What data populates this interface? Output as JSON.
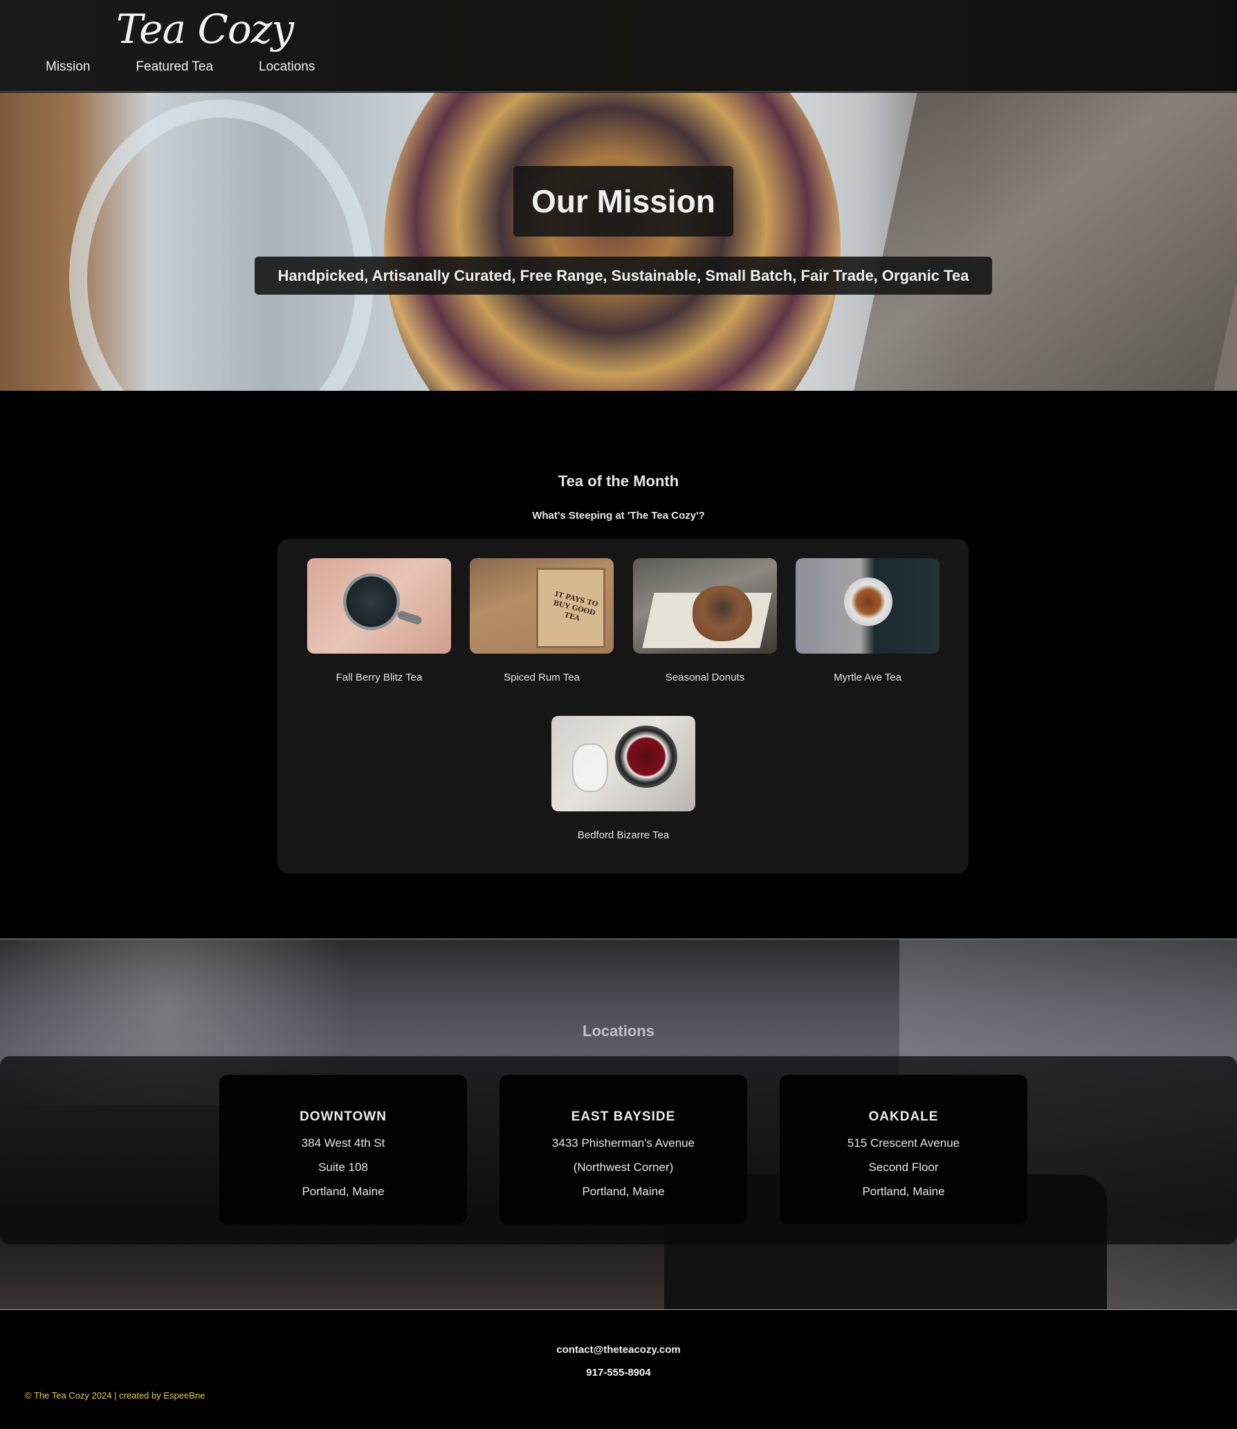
{
  "header": {
    "logo": "Tea Cozy",
    "nav": [
      {
        "label": "Mission"
      },
      {
        "label": "Featured Tea"
      },
      {
        "label": "Locations"
      }
    ]
  },
  "hero": {
    "title": "Our Mission",
    "subtitle": "Handpicked, Artisanally Curated, Free Range, Sustainable, Small Batch, Fair Trade, Organic Tea"
  },
  "featured": {
    "title": "Tea of the Month",
    "subtitle": "What's Steeping at 'The Tea Cozy'?",
    "items": [
      {
        "caption": "Fall Berry Blitz Tea"
      },
      {
        "caption": "Spiced Rum Tea",
        "box_text": "IT PAYS TO BUY GOOD TEA"
      },
      {
        "caption": "Seasonal Donuts"
      },
      {
        "caption": "Myrtle Ave Tea"
      },
      {
        "caption": "Bedford Bizarre Tea"
      }
    ]
  },
  "locations": {
    "title": "Locations",
    "items": [
      {
        "name": "DOWNTOWN",
        "line1": "384 West 4th St",
        "line2": "Suite 108",
        "line3": "Portland, Maine"
      },
      {
        "name": "EAST BAYSIDE",
        "line1": "3433 Phisherman's Avenue",
        "line2": "(Northwest Corner)",
        "line3": "Portland, Maine"
      },
      {
        "name": "OAKDALE",
        "line1": "515 Crescent Avenue",
        "line2": "Second Floor",
        "line3": "Portland, Maine"
      }
    ]
  },
  "footer": {
    "email": "contact@theteacozy.com",
    "phone": "917-555-8904",
    "copyright": "© The Tea Cozy 2024 | created by EspeeBne"
  },
  "colors": {
    "background": "#000000",
    "panel": "#161616",
    "copyright": "#e4c94b"
  }
}
